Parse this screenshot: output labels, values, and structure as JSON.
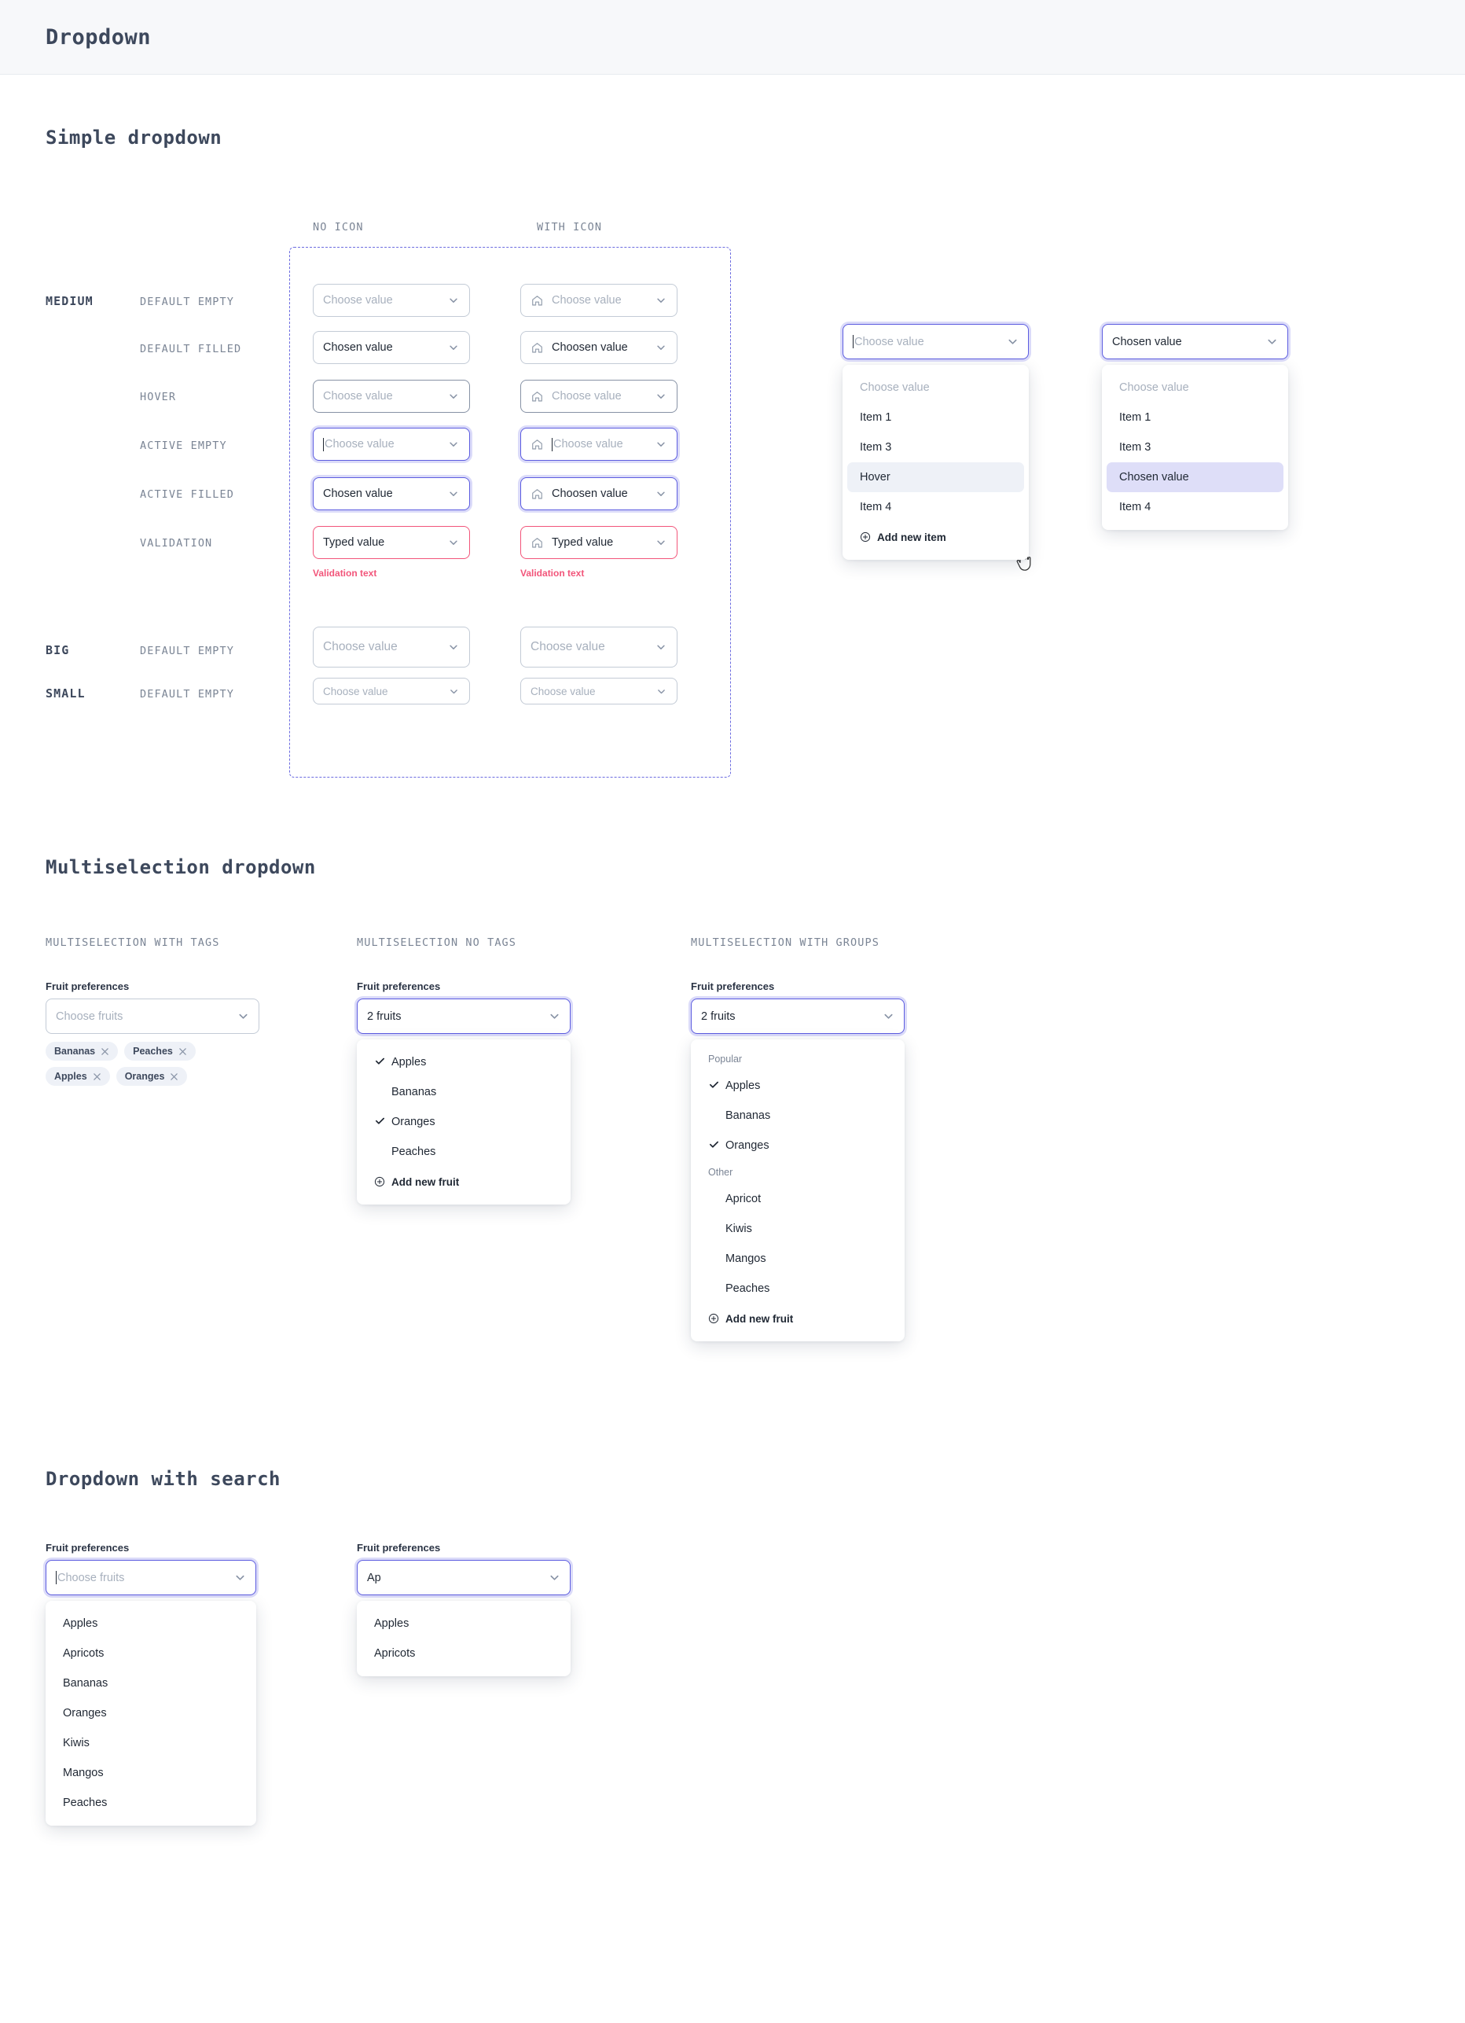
{
  "header": {
    "title": "Dropdown"
  },
  "sections": {
    "simple": {
      "title": "Simple dropdown",
      "col_headers": {
        "no_icon": "NO ICON",
        "with_icon": "WITH ICON"
      },
      "sizes": {
        "medium": "MEDIUM",
        "big": "BIG",
        "small": "SMALL"
      },
      "states": {
        "default_empty": "DEFAULT EMPTY",
        "default_filled": "DEFAULT FILLED",
        "hover": "HOVER",
        "active_empty": "ACTIVE EMPTY",
        "active_filled": "ACTIVE FILLED",
        "validation": "VALIDATION"
      },
      "values": {
        "placeholder": "Choose value",
        "chosen": "Chosen value",
        "choosen_icon": "Choosen value",
        "typed": "Typed value",
        "validation_text": "Validation text"
      }
    },
    "open_menu_empty": {
      "trigger_placeholder": "Choose value",
      "items": [
        {
          "label": "Choose value",
          "state": "muted"
        },
        {
          "label": "Item 1",
          "state": "normal"
        },
        {
          "label": "Item 3",
          "state": "normal"
        },
        {
          "label": "Hover",
          "state": "hovered"
        },
        {
          "label": "Item 4",
          "state": "normal"
        }
      ],
      "add_label": "Add new item"
    },
    "open_menu_selected": {
      "trigger_value": "Chosen value",
      "items": [
        {
          "label": "Choose value",
          "state": "muted"
        },
        {
          "label": "Item 1",
          "state": "normal"
        },
        {
          "label": "Item 3",
          "state": "normal"
        },
        {
          "label": "Chosen value",
          "state": "selected"
        },
        {
          "label": "Item 4",
          "state": "normal"
        }
      ]
    },
    "multiselection": {
      "title": "Multiselection dropdown",
      "col_tags": "MULTISELECTION WITH TAGS",
      "col_no_tags": "MULTISELECTION NO TAGS",
      "col_groups": "MULTISELECTION WITH GROUPS",
      "field_label": "Fruit preferences",
      "with_tags": {
        "placeholder": "Choose fruits",
        "tags": [
          "Bananas",
          "Peaches",
          "Apples",
          "Oranges"
        ]
      },
      "no_tags": {
        "value": "2 fruits",
        "items": [
          {
            "label": "Apples",
            "checked": true
          },
          {
            "label": "Bananas",
            "checked": false
          },
          {
            "label": "Oranges",
            "checked": true
          },
          {
            "label": "Peaches",
            "checked": false
          }
        ],
        "add_label": "Add new fruit"
      },
      "groups": {
        "value": "2 fruits",
        "groups": [
          {
            "name": "Popular",
            "items": [
              {
                "label": "Apples",
                "checked": true
              },
              {
                "label": "Bananas",
                "checked": false
              },
              {
                "label": "Oranges",
                "checked": true
              }
            ]
          },
          {
            "name": "Other",
            "items": [
              {
                "label": "Apricot",
                "checked": false
              },
              {
                "label": "Kiwis",
                "checked": false
              },
              {
                "label": "Mangos",
                "checked": false
              },
              {
                "label": "Peaches",
                "checked": false
              }
            ]
          }
        ],
        "add_label": "Add new fruit"
      }
    },
    "search": {
      "title": "Dropdown with search",
      "field_label": "Fruit preferences",
      "empty": {
        "placeholder": "Choose fruits",
        "items": [
          "Apples",
          "Apricots",
          "Bananas",
          "Oranges",
          "Kiwis",
          "Mangos",
          "Peaches"
        ]
      },
      "typed": {
        "value": "Ap",
        "items": [
          "Apples",
          "Apricots"
        ]
      }
    }
  },
  "icons": {
    "chevron": "chevron-down-icon",
    "home": "home-icon",
    "plus": "plus-circle-icon",
    "check": "check-icon",
    "close": "close-icon",
    "cursor": "pointer-cursor-icon"
  },
  "colors": {
    "accent": "#5c5ce0",
    "accent_soft": "#dedef8",
    "border": "#c3cbd6",
    "error": "#f2557a",
    "muted": "#a7b0bd",
    "header_bg": "#f7f8fa",
    "hover_bg": "#eef1f7"
  }
}
